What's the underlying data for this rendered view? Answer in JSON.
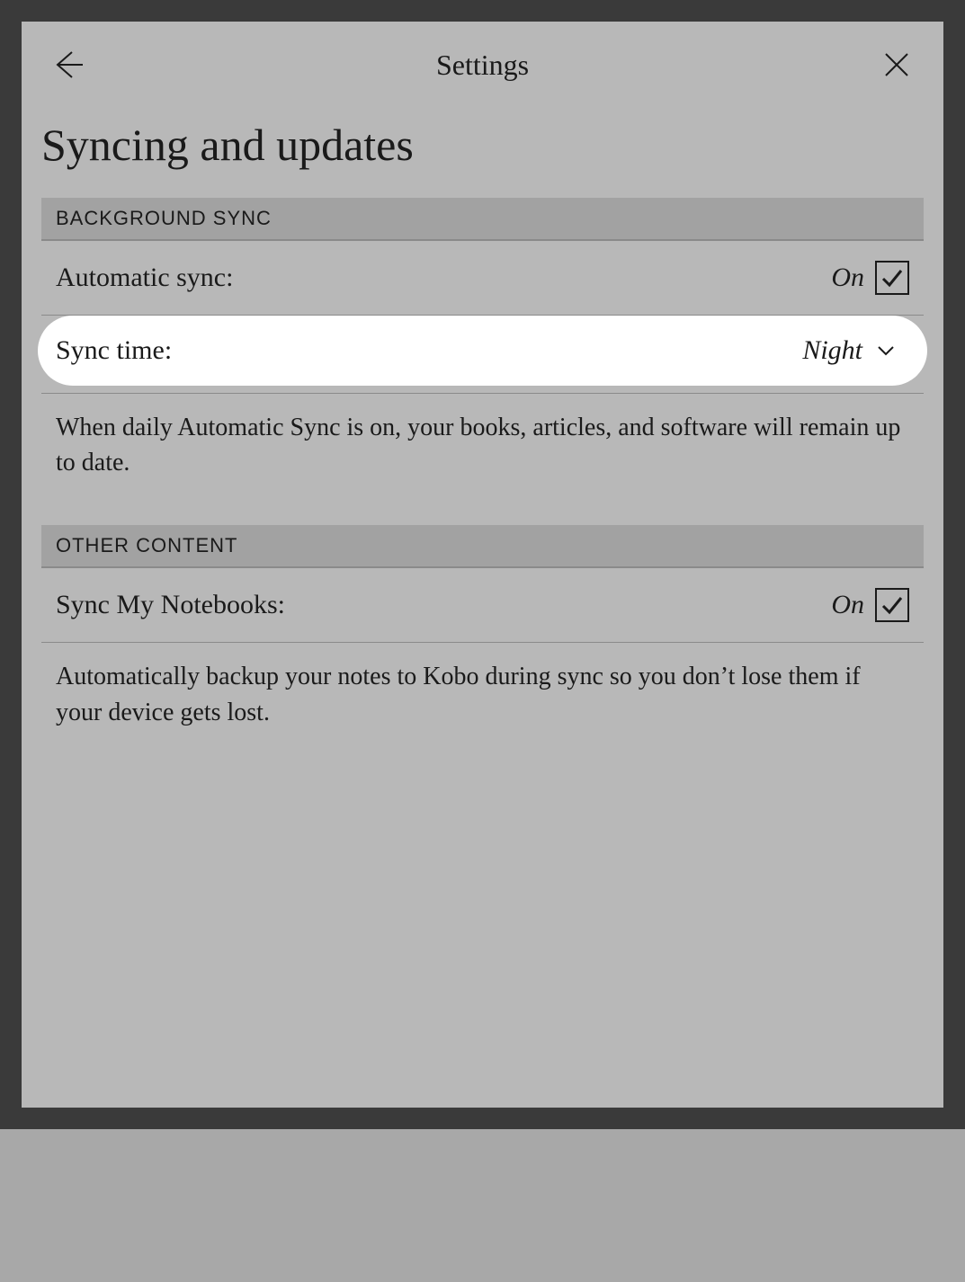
{
  "header": {
    "title": "Settings"
  },
  "page": {
    "title": "Syncing and updates"
  },
  "sections": {
    "background_sync": {
      "header": "BACKGROUND SYNC",
      "automatic_sync": {
        "label": "Automatic sync:",
        "value": "On"
      },
      "sync_time": {
        "label": "Sync time:",
        "value": "Night"
      },
      "description": "When daily Automatic Sync is on, your books, articles, and software will remain up to date."
    },
    "other_content": {
      "header": "OTHER CONTENT",
      "sync_notebooks": {
        "label": "Sync My Notebooks:",
        "value": "On"
      },
      "description": "Automatically backup your notes to Kobo during sync so you don’t lose them if your device gets lost."
    }
  }
}
